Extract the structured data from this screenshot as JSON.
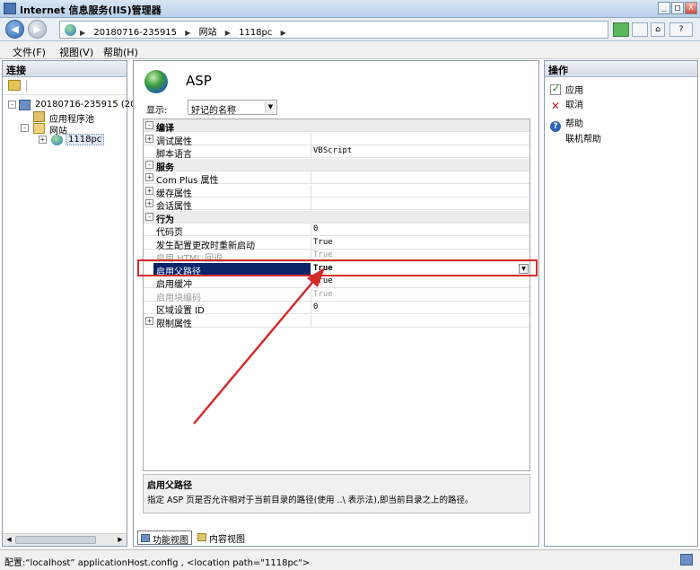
{
  "window": {
    "title": "Internet 信息服务(IIS)管理器",
    "minimize_glyph": "_",
    "maximize_glyph": "□",
    "close_glyph": "X"
  },
  "address": {
    "breadcrumbs": [
      "20180716-235915",
      "网站",
      "1118pc"
    ],
    "separator": "▶",
    "back_glyph": "◀",
    "forward_glyph": "▶"
  },
  "toolbar_icons": [
    "refresh-icon",
    "stop-icon",
    "home-icon",
    "help-icon"
  ],
  "toolbar_icon_glyphs": {
    "home": "⌂",
    "help": "?"
  },
  "menu": {
    "items": [
      "文件(F)",
      "视图(V)",
      "帮助(H)"
    ]
  },
  "connections": {
    "header": "连接",
    "tree": {
      "server": "20180716-235915  (20",
      "app_pools": "应用程序池",
      "sites": "网站",
      "site": "1118pc"
    },
    "expand_glyph": "+",
    "collapse_glyph": "-"
  },
  "feature": {
    "title": "ASP",
    "show_label": "显示:",
    "show_value": "好记的名称",
    "dropdown_glyph": "▼"
  },
  "property_grid": {
    "rows": [
      {
        "kind": "category",
        "expander": "-",
        "name": "编译"
      },
      {
        "kind": "prop",
        "expander": "+",
        "name": "调试属性",
        "value": ""
      },
      {
        "kind": "prop",
        "expander": "",
        "name": "脚本语言",
        "value": "VBScript"
      },
      {
        "kind": "category",
        "expander": "-",
        "name": "服务"
      },
      {
        "kind": "prop",
        "expander": "+",
        "name": "Com Plus 属性",
        "value": ""
      },
      {
        "kind": "prop",
        "expander": "+",
        "name": "缓存属性",
        "value": ""
      },
      {
        "kind": "prop",
        "expander": "+",
        "name": "会话属性",
        "value": ""
      },
      {
        "kind": "category",
        "expander": "-",
        "name": "行为"
      },
      {
        "kind": "prop",
        "expander": "",
        "name": "代码页",
        "value": "0"
      },
      {
        "kind": "prop",
        "expander": "",
        "name": "发生配置更改时重新启动",
        "value": "True"
      },
      {
        "kind": "disabled",
        "expander": "",
        "name": "启用 HTML 回退",
        "value": "True"
      },
      {
        "kind": "selected",
        "expander": "",
        "name": "启用父路径",
        "value": "True"
      },
      {
        "kind": "prop",
        "expander": "",
        "name": "启用缓冲",
        "value": "True"
      },
      {
        "kind": "disabled",
        "expander": "",
        "name": "启用块编码",
        "value": "True"
      },
      {
        "kind": "prop",
        "expander": "",
        "name": "区域设置 ID",
        "value": "0"
      },
      {
        "kind": "prop",
        "expander": "+",
        "name": "限制属性",
        "value": ""
      }
    ]
  },
  "description": {
    "title": "启用父路径",
    "text": "指定 ASP 页是否允许相对于当前目录的路径(使用 ..\\ 表示法),即当前目录之上的路径。"
  },
  "view_tabs": {
    "features": "功能视图",
    "content": "内容视图"
  },
  "actions": {
    "header": "操作",
    "apply": "应用",
    "cancel": "取消",
    "cancel_glyph": "✕",
    "help": "帮助",
    "help_glyph": "?",
    "online_help": "联机帮助"
  },
  "status": {
    "text": "配置:“localhost” applicationHost.config , <location path=\"1118pc\">"
  },
  "annotation": {
    "color": "#d42b2b"
  }
}
